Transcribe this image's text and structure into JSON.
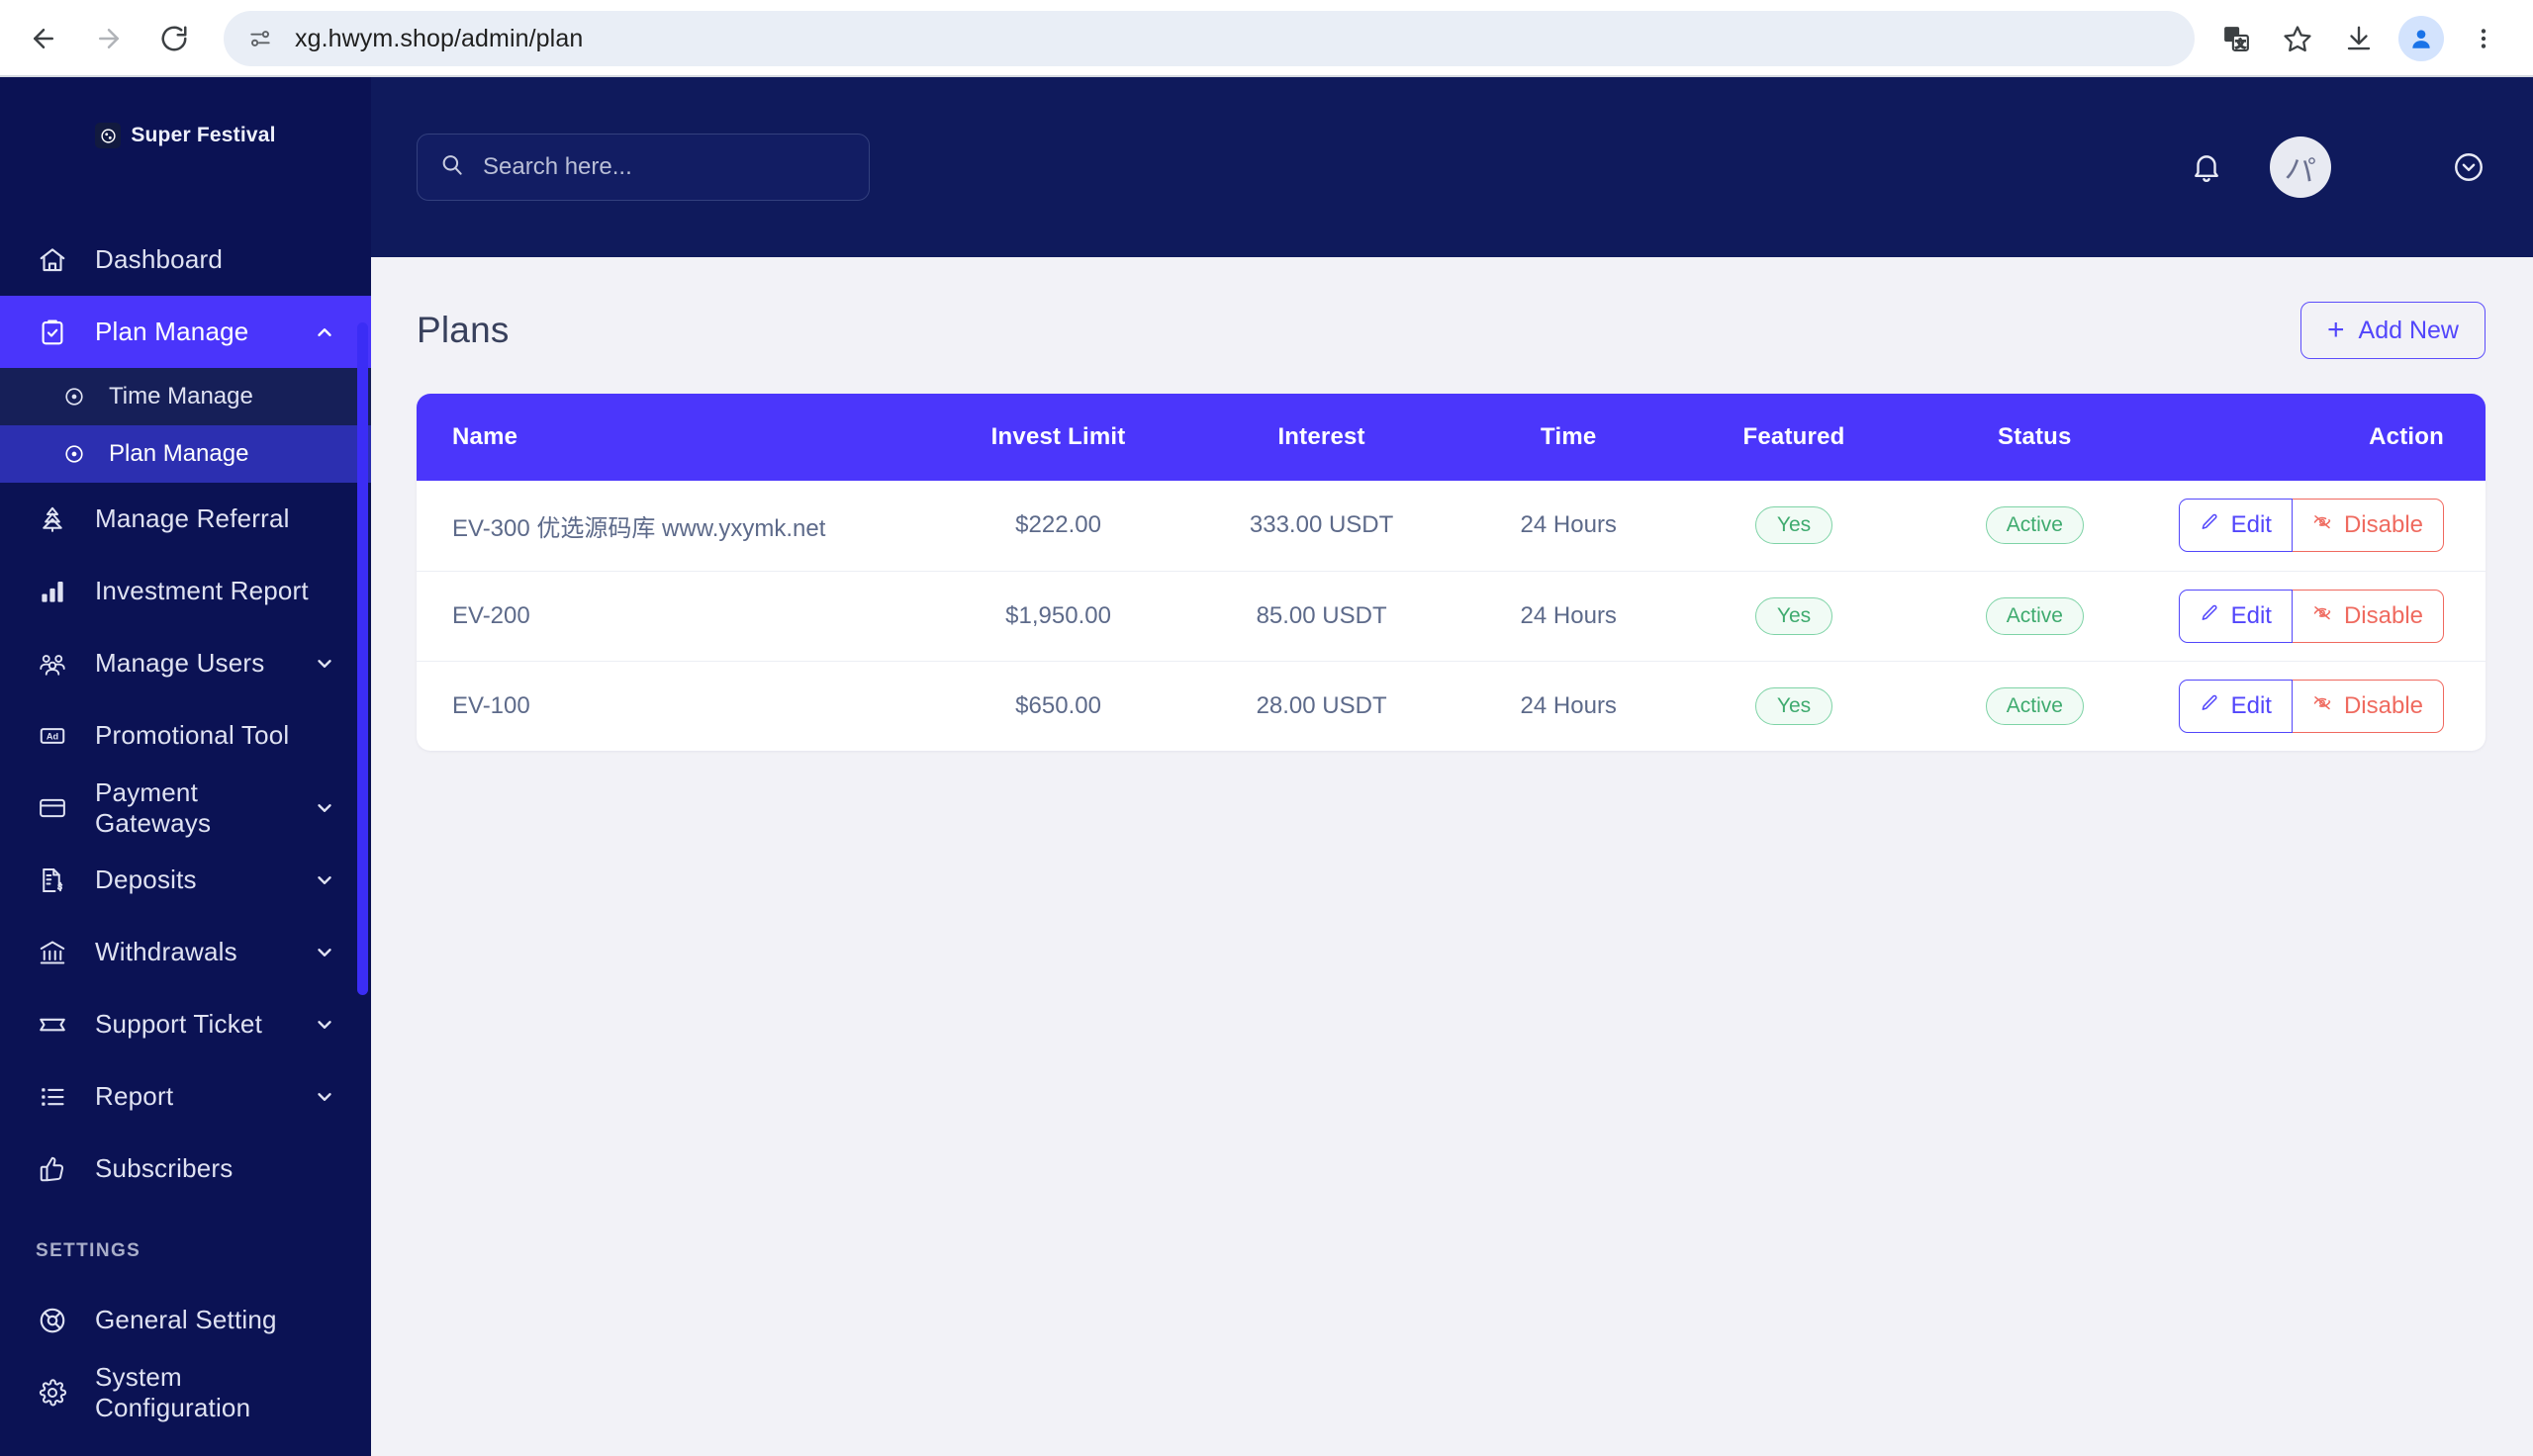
{
  "browser": {
    "url": "xg.hwym.shop/admin/plan",
    "back_label": "Back",
    "forward_label": "Forward",
    "reload_label": "Reload",
    "site_info_label": "View site information",
    "translate_label": "Translate this page",
    "bookmark_label": "Bookmark this tab",
    "download_label": "Downloads",
    "profile_label": "Profile",
    "menu_label": "Customize and control Chrome"
  },
  "sidebar": {
    "logo": {
      "text": "Super Festival",
      "icon": "globe-icon"
    },
    "items": [
      {
        "label": "Dashboard",
        "icon": "home-icon",
        "active": false,
        "expandable": false
      },
      {
        "label": "Plan Manage",
        "icon": "clipboard-check-icon",
        "active": true,
        "expandable": true,
        "expanded": true
      },
      {
        "label": "Manage Referral",
        "icon": "referral-tree-icon",
        "active": false,
        "expandable": false
      },
      {
        "label": "Investment Report",
        "icon": "bar-chart-icon",
        "active": false,
        "expandable": false
      },
      {
        "label": "Manage Users",
        "icon": "users-icon",
        "active": false,
        "expandable": true
      },
      {
        "label": "Promotional Tool",
        "icon": "ad-box-icon",
        "active": false,
        "expandable": false
      },
      {
        "label": "Payment Gateways",
        "icon": "credit-card-icon",
        "active": false,
        "expandable": true
      },
      {
        "label": "Deposits",
        "icon": "document-dollar-icon",
        "active": false,
        "expandable": true
      },
      {
        "label": "Withdrawals",
        "icon": "bank-icon",
        "active": false,
        "expandable": true
      },
      {
        "label": "Support Ticket",
        "icon": "ticket-icon",
        "active": false,
        "expandable": true
      },
      {
        "label": "Report",
        "icon": "list-icon",
        "active": false,
        "expandable": true
      },
      {
        "label": "Subscribers",
        "icon": "thumbs-up-icon",
        "active": false,
        "expandable": false
      }
    ],
    "submenu": [
      {
        "label": "Time Manage",
        "icon": "circle-dot-icon",
        "active": false
      },
      {
        "label": "Plan Manage",
        "icon": "circle-dot-icon",
        "active": true
      }
    ],
    "settings_label": "SETTINGS",
    "settings_items": [
      {
        "label": "General Setting",
        "icon": "life-ring-icon"
      },
      {
        "label": "System Configuration",
        "icon": "gear-icon"
      }
    ]
  },
  "topbar": {
    "search_placeholder": "Search here...",
    "search_value": "",
    "notifications_label": "Notifications",
    "avatar_label": "User avatar",
    "account_menu_label": "Account menu"
  },
  "page": {
    "title": "Plans",
    "add_new_label": "Add New",
    "add_new_plus": "+"
  },
  "table": {
    "columns": [
      "Name",
      "Invest Limit",
      "Interest",
      "Time",
      "Featured",
      "Status",
      "Action"
    ],
    "rows": [
      {
        "name": "EV-300 优选源码库 www.yxymk.net",
        "invest_limit": "$222.00",
        "interest": "333.00 USDT",
        "time": "24 Hours",
        "featured": "Yes",
        "status": "Active",
        "edit_label": "Edit",
        "disable_label": "Disable"
      },
      {
        "name": "EV-200",
        "invest_limit": "$1,950.00",
        "interest": "85.00 USDT",
        "time": "24 Hours",
        "featured": "Yes",
        "status": "Active",
        "edit_label": "Edit",
        "disable_label": "Disable"
      },
      {
        "name": "EV-100",
        "invest_limit": "$650.00",
        "interest": "28.00 USDT",
        "time": "24 Hours",
        "featured": "Yes",
        "status": "Active",
        "edit_label": "Edit",
        "disable_label": "Disable"
      }
    ]
  },
  "colors": {
    "sidebar_bg": "#0b1254",
    "topbar_bg": "#0f1a5c",
    "accent": "#4b36fb",
    "active_nav": "#4a35fb",
    "success": "#3fab6f",
    "danger": "#ef6a5f",
    "page_bg": "#f2f2f7"
  }
}
